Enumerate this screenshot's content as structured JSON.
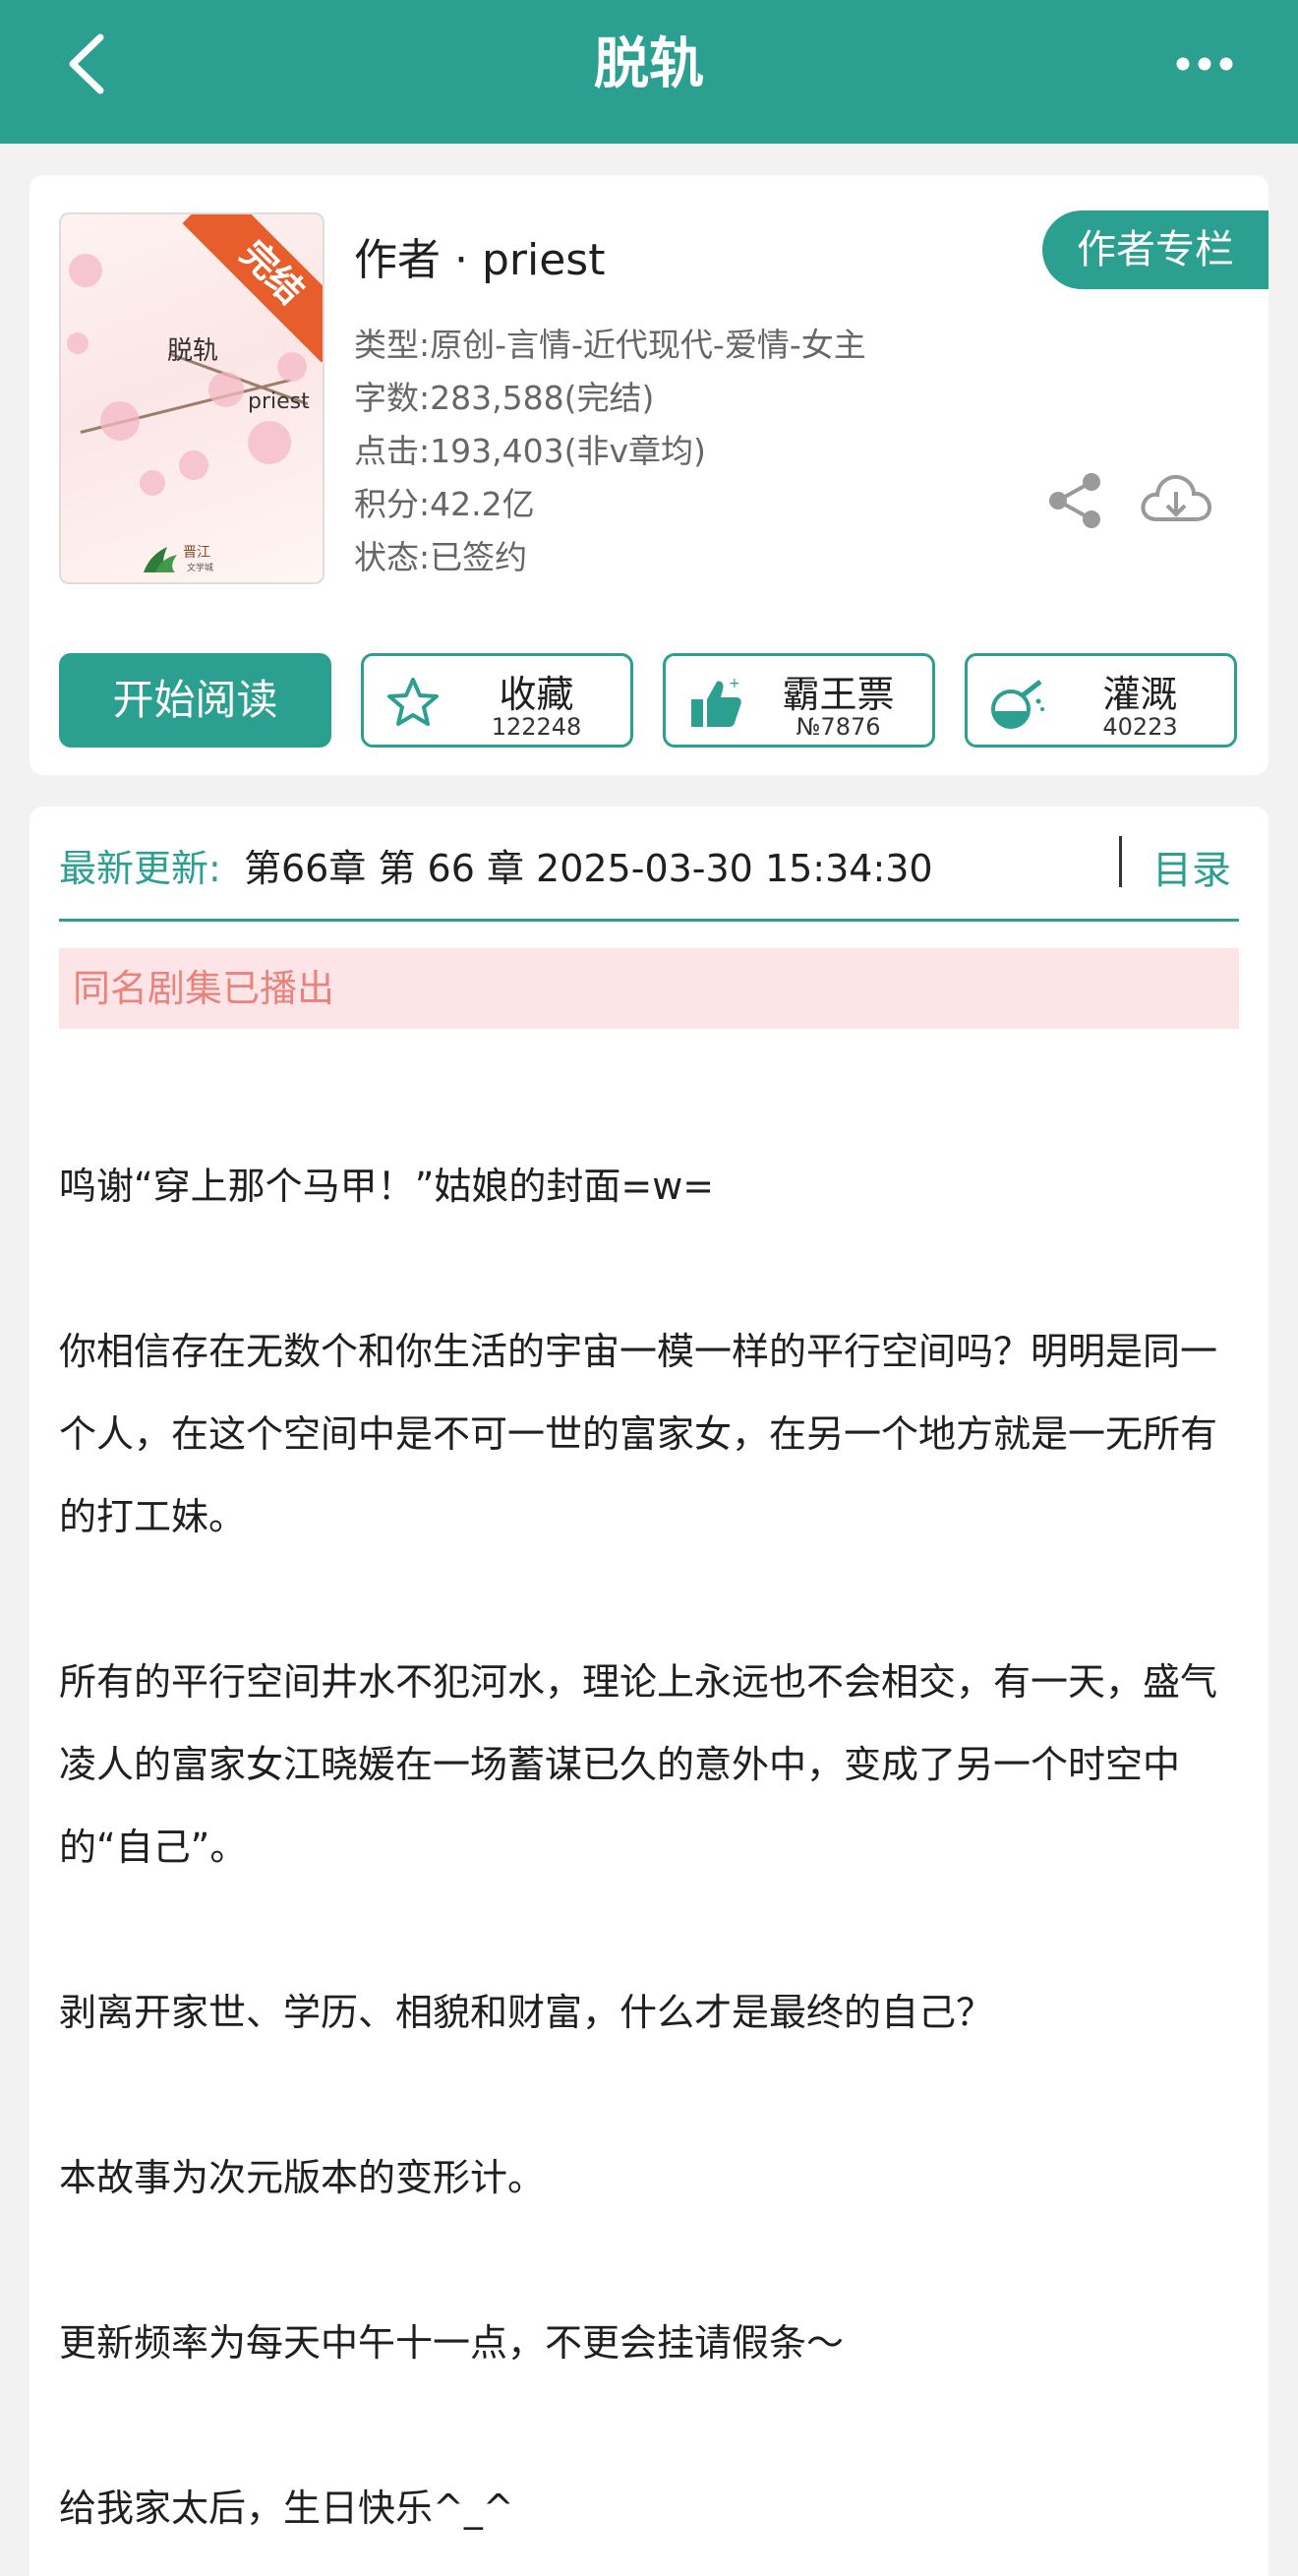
{
  "header": {
    "title": "脱轨",
    "back_icon": "chevron-left-icon",
    "more_icon": "more-dots-icon",
    "color": "#2ba091"
  },
  "book": {
    "cover": {
      "badge": "完结",
      "title": "脱轨",
      "author": "priest",
      "logo_text": "晋江文学城"
    },
    "author_line": "作者 · priest",
    "author_column_button": "作者专栏",
    "meta": [
      "类型:原创-言情-近代现代-爱情-女主",
      "字数:283,588(完结)",
      "点击:193,403(非v章均)",
      "积分:42.2亿",
      "状态:已签约"
    ],
    "share_icon": "share-icon",
    "download_icon": "cloud-download-icon"
  },
  "actions": {
    "read": "开始阅读",
    "favorite": {
      "label": "收藏",
      "count": "122248",
      "icon": "star-icon"
    },
    "vote": {
      "label": "霸王票",
      "count": "№7876",
      "icon": "thumbs-up-icon"
    },
    "nourish": {
      "label": "灌溉",
      "count": "40223",
      "icon": "flask-icon"
    }
  },
  "latest": {
    "label": "最新更新:",
    "text": "第66章 第 66 章 2025-03-30 15:34:30",
    "toc": "目录"
  },
  "notice": "同名剧集已播出",
  "intro": [
    "鸣谢“穿上那个马甲！”姑娘的封面=w=",
    "你相信存在无数个和你生活的宇宙一模一样的平行空间吗？明明是同一个人，在这个空间中是不可一世的富家女，在另一个地方就是一无所有的打工妹。",
    "所有的平行空间井水不犯河水，理论上永远也不会相交，有一天，盛气凌人的富家女江晓媛在一场蓄谋已久的意外中，变成了另一个时空中的“自己”。",
    "剥离开家世、学历、相貌和财富，什么才是最终的自己？",
    "本故事为次元版本的变形计。",
    "更新频率为每天中午十一点，不更会挂请假条～",
    "给我家太后，生日快乐^_^"
  ]
}
